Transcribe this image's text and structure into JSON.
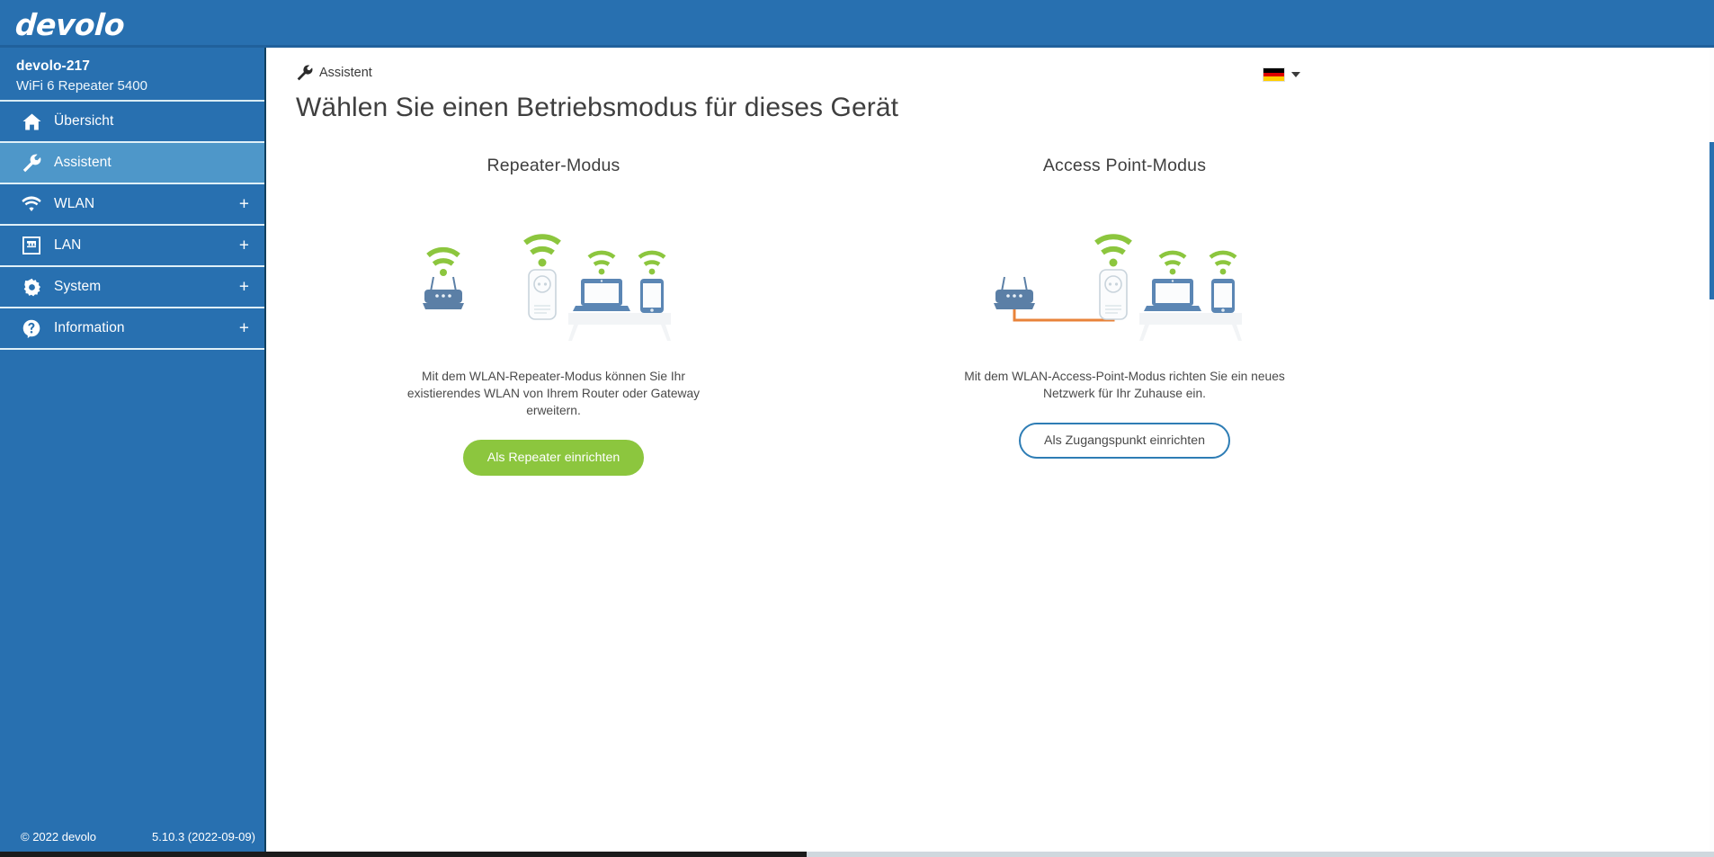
{
  "brand": {
    "logo_text": "devolo"
  },
  "sidebar": {
    "device": {
      "name": "devolo-217",
      "model": "WiFi 6 Repeater 5400"
    },
    "items": [
      {
        "label": "Übersicht",
        "icon": "home-icon",
        "expander": "",
        "active": false
      },
      {
        "label": "Assistent",
        "icon": "wrench-icon",
        "expander": "",
        "active": true
      },
      {
        "label": "WLAN",
        "icon": "wifi-icon",
        "expander": "+",
        "active": false
      },
      {
        "label": "LAN",
        "icon": "ethernet-icon",
        "expander": "+",
        "active": false
      },
      {
        "label": "System",
        "icon": "gear-icon",
        "expander": "+",
        "active": false
      },
      {
        "label": "Information",
        "icon": "help-icon",
        "expander": "+",
        "active": false
      }
    ],
    "footer": {
      "copyright": "© 2022 devolo",
      "version": "5.10.3 (2022-09-09)"
    }
  },
  "content": {
    "breadcrumb": {
      "icon": "wrench-icon",
      "label": "Assistent"
    },
    "language": {
      "flag": "flag-de-icon",
      "caret": "chevron-down-icon"
    },
    "page_title": "Wählen Sie einen Betriebsmodus für dieses Gerät",
    "modes": [
      {
        "title": "Repeater-Modus",
        "description": "Mit dem WLAN-Repeater-Modus können Sie Ihr existierendes WLAN von Ihrem Router oder Gateway erweitern.",
        "button_label": "Als Repeater einrichten",
        "button_style": "primary"
      },
      {
        "title": "Access Point-Modus",
        "description": "Mit dem WLAN-Access-Point-Modus richten Sie ein neues Netzwerk für Ihr Zuhause ein.",
        "button_label": "Als Zugangspunkt einrichten",
        "button_style": "outline"
      }
    ]
  },
  "colors": {
    "brand_blue": "#2870b0",
    "active_blue": "#4e97c9",
    "accent_green": "#8cc63e",
    "outline_blue": "#2e7db5",
    "cable_orange": "#e8833a",
    "device_blue": "#5b7fa6"
  }
}
